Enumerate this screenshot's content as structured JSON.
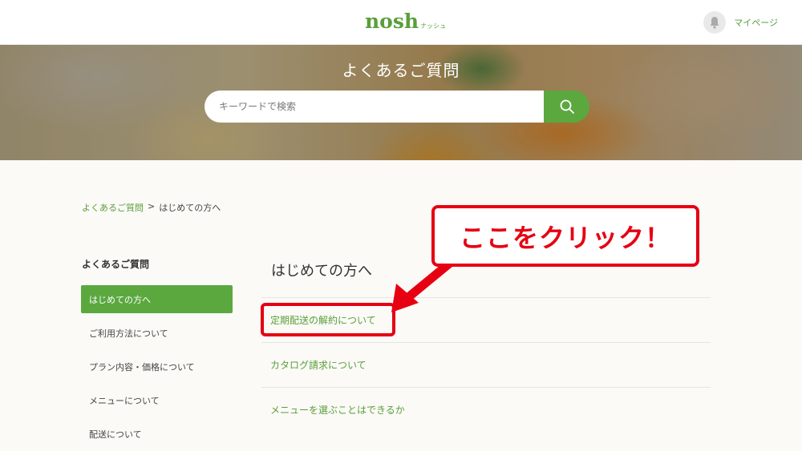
{
  "header": {
    "logo_main": "nosh",
    "logo_sub": "ナッシュ",
    "mypage_label": "マイページ"
  },
  "hero": {
    "title": "よくあるご質問",
    "search_placeholder": "キーワードで検索"
  },
  "breadcrumb": {
    "home": "よくあるご質問",
    "separator": ">",
    "current": "はじめての方へ"
  },
  "sidebar": {
    "heading": "よくあるご質問",
    "items": [
      {
        "label": "はじめての方へ"
      },
      {
        "label": "ご利用方法について"
      },
      {
        "label": "プラン内容・価格について"
      },
      {
        "label": "メニューについて"
      },
      {
        "label": "配送について"
      }
    ]
  },
  "main": {
    "title": "はじめての方へ",
    "questions": [
      {
        "label": "定期配送の解約について"
      },
      {
        "label": "カタログ請求について"
      },
      {
        "label": "メニューを選ぶことはできるか"
      }
    ]
  },
  "annotation": {
    "callout_text": "ここをクリック！"
  },
  "colors": {
    "brand_green": "#5ba83f",
    "annotation_red": "#e60012"
  }
}
